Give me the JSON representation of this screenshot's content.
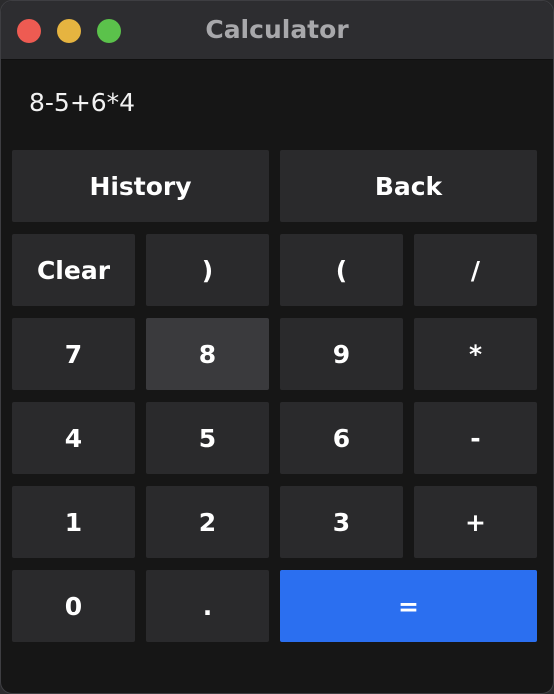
{
  "window": {
    "title": "Calculator"
  },
  "display": {
    "expression": "8-5+6*4"
  },
  "buttons": {
    "history": "History",
    "back": "Back",
    "clear": "Clear",
    "rparen": ")",
    "lparen": "(",
    "divide": "/",
    "seven": "7",
    "eight": "8",
    "nine": "9",
    "multiply": "*",
    "four": "4",
    "five": "5",
    "six": "6",
    "minus": "-",
    "one": "1",
    "two": "2",
    "three": "3",
    "plus": "+",
    "zero": "0",
    "dot": ".",
    "equals": "="
  },
  "colors": {
    "accent": "#2b6ff0",
    "button": "#2a2a2c",
    "button_active": "#3a3a3d",
    "background": "#161616"
  }
}
